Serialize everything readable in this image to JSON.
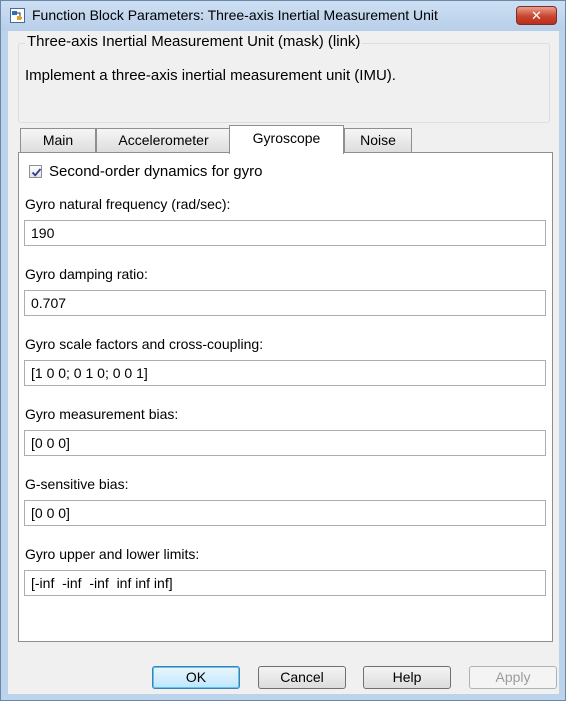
{
  "window": {
    "title": "Function Block Parameters: Three-axis Inertial Measurement Unit",
    "close_symbol": "✕"
  },
  "block": {
    "name": "Three-axis Inertial Measurement Unit (mask) (link)",
    "description": "Implement a three-axis inertial measurement unit (IMU)."
  },
  "tabs": [
    {
      "label": "Main",
      "active": false
    },
    {
      "label": "Accelerometer",
      "active": false
    },
    {
      "label": "Gyroscope",
      "active": true
    },
    {
      "label": "Noise",
      "active": false
    }
  ],
  "gyroscope": {
    "second_order": {
      "label": "Second-order dynamics for gyro",
      "checked": true
    },
    "fields": [
      {
        "label": "Gyro natural frequency (rad/sec):",
        "value": "190"
      },
      {
        "label": "Gyro damping ratio:",
        "value": "0.707"
      },
      {
        "label": "Gyro scale factors and cross-coupling:",
        "value": "[1 0 0; 0 1 0; 0 0 1]"
      },
      {
        "label": "Gyro measurement bias:",
        "value": "[0 0 0]"
      },
      {
        "label": "G-sensitive bias:",
        "value": "[0 0 0]"
      },
      {
        "label": "Gyro upper and lower limits:",
        "value": "[-inf  -inf  -inf  inf inf inf]"
      }
    ]
  },
  "buttons": {
    "ok": "OK",
    "cancel": "Cancel",
    "help": "Help",
    "apply": "Apply"
  },
  "icons": {
    "title": "simulink-block-icon",
    "close": "close-icon",
    "check": "checkmark-icon"
  }
}
